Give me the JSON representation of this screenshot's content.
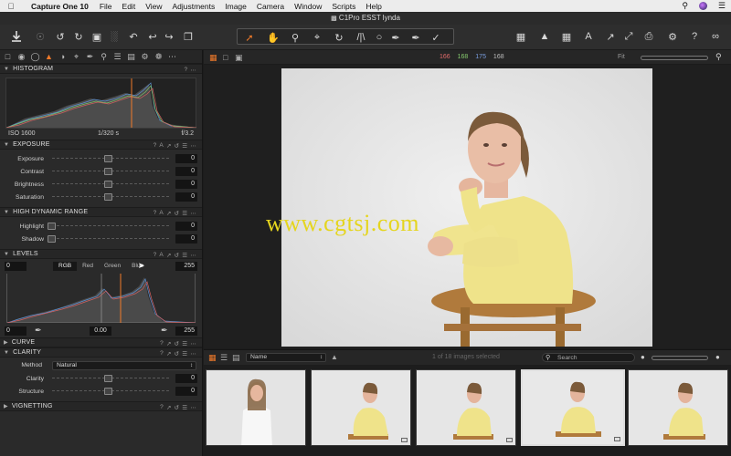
{
  "menubar": {
    "app_name": "Capture One 10",
    "items": [
      "File",
      "Edit",
      "View",
      "Adjustments",
      "Image",
      "Camera",
      "Window",
      "Scripts",
      "Help"
    ]
  },
  "window": {
    "title": "C1Pro ESST lynda"
  },
  "viewer": {
    "rgb_readout": {
      "r": "166",
      "g": "168",
      "b": "175",
      "l": "168"
    },
    "zoom_label": "Fit"
  },
  "histogram": {
    "title": "HISTOGRAM",
    "iso": "ISO 1600",
    "shutter": "1/320 s",
    "aperture": "f/3.2"
  },
  "exposure": {
    "title": "EXPOSURE",
    "sliders": [
      {
        "label": "Exposure",
        "value": "0"
      },
      {
        "label": "Contrast",
        "value": "0"
      },
      {
        "label": "Brightness",
        "value": "0"
      },
      {
        "label": "Saturation",
        "value": "0"
      }
    ]
  },
  "hdr": {
    "title": "HIGH DYNAMIC RANGE",
    "sliders": [
      {
        "label": "Highlight",
        "value": "0"
      },
      {
        "label": "Shadow",
        "value": "0"
      }
    ]
  },
  "levels": {
    "title": "LEVELS",
    "input_low": "0",
    "input_high": "255",
    "channels": [
      "RGB",
      "Red",
      "Green",
      "Blue"
    ],
    "active_channel": "RGB",
    "output_low": "0",
    "midpoint": "0.00",
    "output_high": "255"
  },
  "curve": {
    "title": "CURVE"
  },
  "clarity": {
    "title": "CLARITY",
    "method_label": "Method",
    "method_value": "Natural",
    "sliders": [
      {
        "label": "Clarity",
        "value": "0"
      },
      {
        "label": "Structure",
        "value": "0"
      }
    ]
  },
  "vignetting": {
    "title": "VIGNETTING"
  },
  "browser": {
    "sort_field": "Name",
    "selection_status": "1 of 18 images selected",
    "search_placeholder": "Search"
  },
  "watermark": "www.cgtsj.com",
  "colors": {
    "accent": "#f07a2a",
    "panel": "#2a2a2a",
    "sweater": "#efe38a",
    "background_paper": "#e8e8e8"
  }
}
